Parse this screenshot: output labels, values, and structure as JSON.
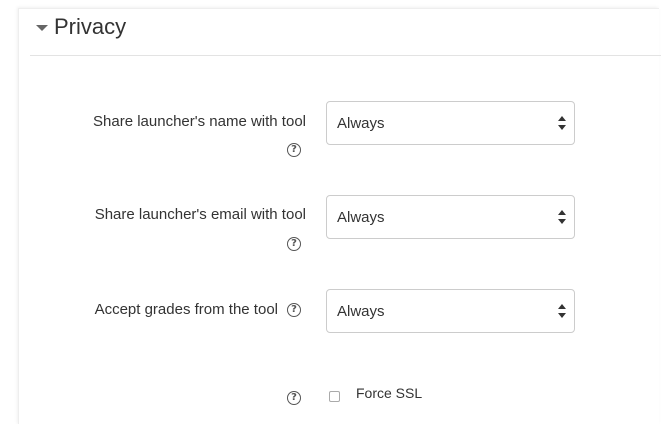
{
  "section": {
    "title": "Privacy",
    "caret_icon": "caret-down-icon"
  },
  "fields": [
    {
      "label": "Share launcher's name with tool",
      "value": "Always",
      "help_icon": "question-circle-icon"
    },
    {
      "label": "Share launcher's email with tool",
      "value": "Always",
      "help_icon": "question-circle-icon"
    },
    {
      "label": "Accept grades from the tool",
      "value": "Always",
      "help_icon": "question-circle-icon"
    }
  ],
  "force_ssl": {
    "label": "Force SSL",
    "checked": false,
    "help_icon": "question-circle-icon"
  }
}
